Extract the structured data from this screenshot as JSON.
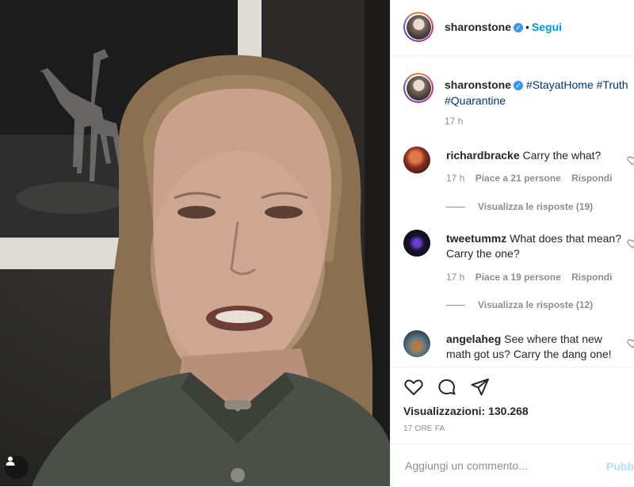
{
  "post": {
    "username": "sharonstone",
    "follow_label": "Segui",
    "dot": "•",
    "verified_glyph": "✓",
    "caption_hashtags": [
      "#StayatHome",
      "#Truth",
      "#Quarantine"
    ],
    "caption_time": "17 h"
  },
  "comments": [
    {
      "user": "richardbracke",
      "text": "Carry the what?",
      "time": "17 h",
      "likes": "Piace a 21 persone",
      "reply": "Rispondi",
      "view_replies": "Visualizza le risposte (19)"
    },
    {
      "user": "tweetummz",
      "text": "What does that mean? Carry the one?",
      "time": "17 h",
      "likes": "Piace a 19 persone",
      "reply": "Rispondi",
      "view_replies": "Visualizza le risposte (12)"
    },
    {
      "user": "angelaheg",
      "text": "See where that new math got us? Carry the dang one!"
    }
  ],
  "actions": {
    "like_icon": "heart-icon",
    "comment_icon": "comment-icon",
    "share_icon": "share-icon"
  },
  "views_label": "Visualizzazioni: 130.268",
  "time_ago": "17 ORE FA",
  "add_comment": {
    "placeholder": "Aggiungi un commento...",
    "publish_label": "Pubb"
  },
  "colors": {
    "accent": "#0095f6",
    "hashtag": "#00376b",
    "muted": "#8e8e8e",
    "publish_disabled": "#b2dffc"
  }
}
